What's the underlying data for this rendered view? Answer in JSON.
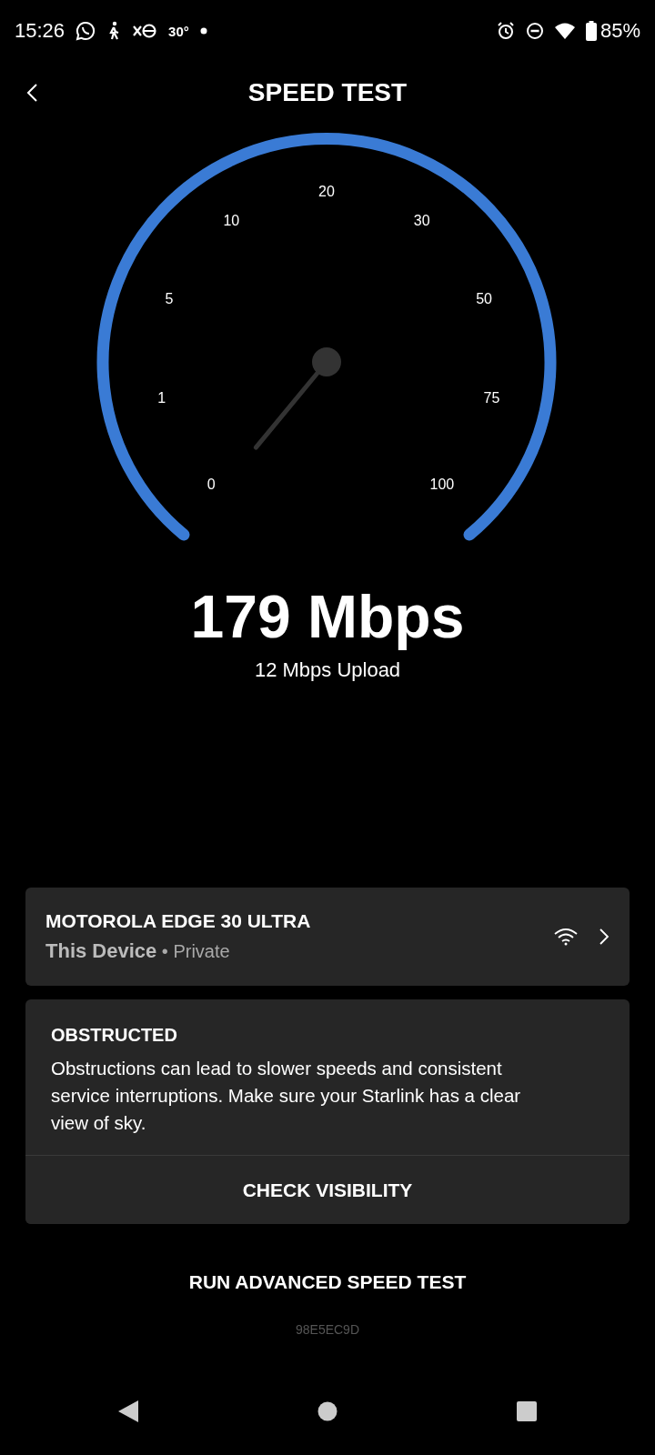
{
  "status_bar": {
    "time": "15:26",
    "temperature": "30°",
    "battery": "85%"
  },
  "header": {
    "title": "SPEED TEST"
  },
  "gauge": {
    "ticks": [
      "0",
      "1",
      "5",
      "10",
      "20",
      "30",
      "50",
      "75",
      "100"
    ]
  },
  "result": {
    "download": "179 Mbps",
    "upload": "12 Mbps Upload"
  },
  "device": {
    "name": "MOTOROLA EDGE 30 ULTRA",
    "subtitle": "**This Device** • Private"
  },
  "alert": {
    "title": "OBSTRUCTED",
    "message": "Obstructions can lead to slower speeds and consistent service interruptions. Make sure your Starlink has a clear view of sky.",
    "action": "CHECK VISIBILITY"
  },
  "advanced_button": "RUN ADVANCED SPEED TEST",
  "device_code": "98E5EC9D"
}
